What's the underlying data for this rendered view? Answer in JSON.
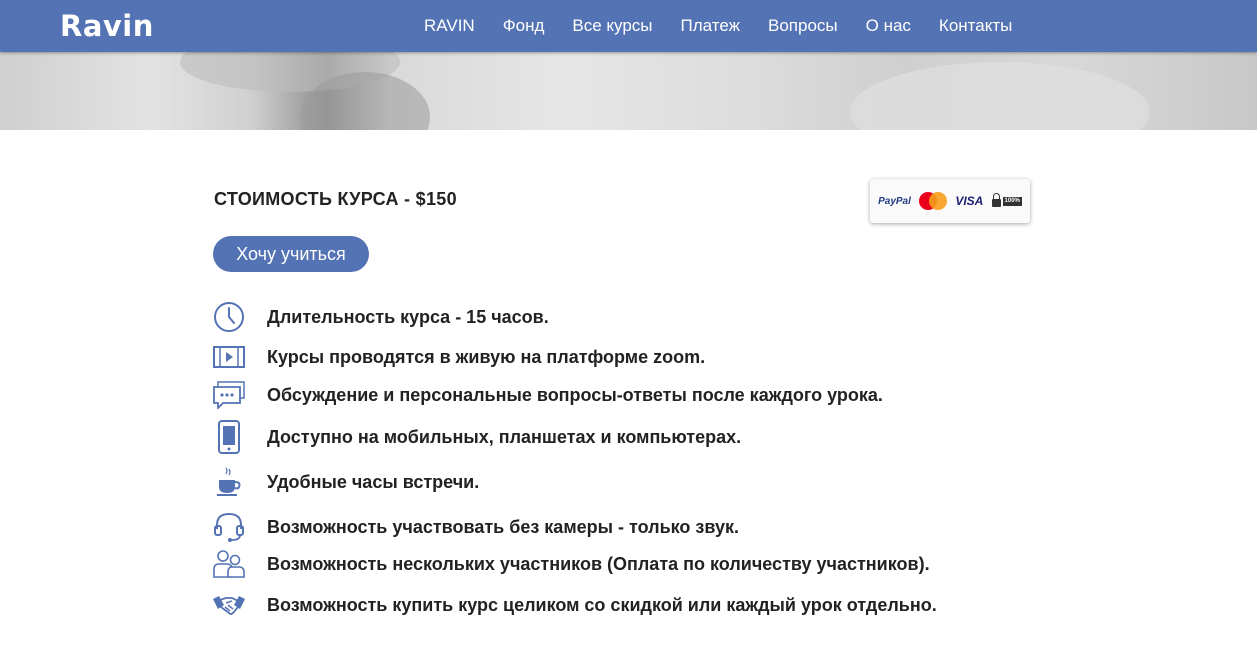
{
  "header": {
    "logo": "Ravin",
    "nav": [
      "RAVIN",
      "Фонд",
      "Все курсы",
      "Платеж",
      "Вопросы",
      "О нас",
      "Контакты"
    ]
  },
  "course": {
    "price_title": "СТОИМОСТЬ КУРСА - $150",
    "cta_label": "Хочу учиться",
    "payment_logos": [
      "PayPal",
      "MasterCard",
      "VISA",
      "100% SECURE"
    ]
  },
  "features": [
    {
      "icon": "clock-icon",
      "text": "Длительность курса - 15 часов."
    },
    {
      "icon": "video-icon",
      "text": "Курсы проводятся в живую на платформе zoom."
    },
    {
      "icon": "chat-icon",
      "text": "Обсуждение и персональные вопросы-ответы после каждого урока."
    },
    {
      "icon": "mobile-icon",
      "text": "Доступно на мобильных, планшетах и компьютерах."
    },
    {
      "icon": "coffee-icon",
      "text": "Удобные часы встречи."
    },
    {
      "icon": "headset-icon",
      "text": "Возможность участвовать без камеры - только звук."
    },
    {
      "icon": "users-icon",
      "text": "Возможность нескольких участников (Оплата по количеству участников)."
    },
    {
      "icon": "handshake-icon",
      "text": "Возможность купить курс целиком  со скидкой или каждый урок отдельно."
    }
  ],
  "colors": {
    "brand": "#5473b4",
    "text": "#222222"
  }
}
